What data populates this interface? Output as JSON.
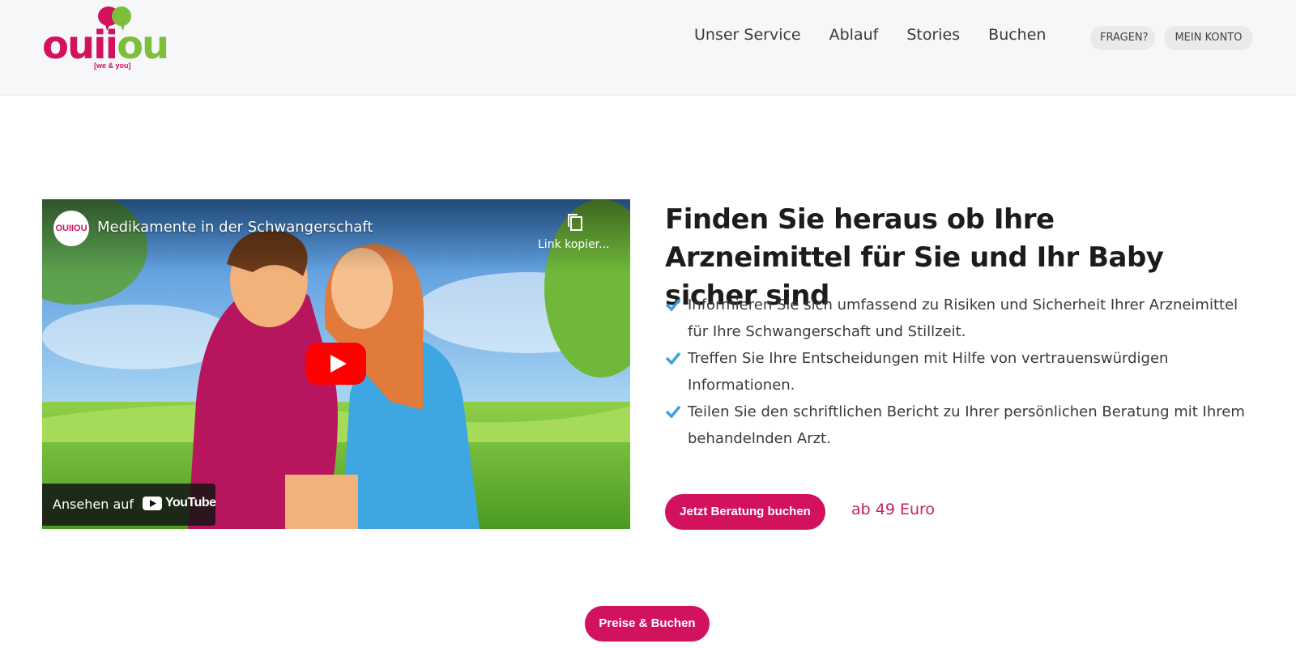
{
  "brand": {
    "logo_text_pink": "ou",
    "logo_text_mid": "ii",
    "logo_text_green": "ou",
    "logo_tagline": "[we & you]",
    "pink": "#d2125f",
    "green": "#7dbf3b"
  },
  "nav": {
    "items": [
      "Unser Service",
      "Ablauf",
      "Stories",
      "Buchen"
    ],
    "ask_label": "FRAGEN?",
    "account_label": "MEIN KONTO"
  },
  "video": {
    "channel_avatar": "OUIIOU",
    "title": "Medikamente in der Schwangerschaft",
    "copy_link_label": "Link kopier...",
    "watch_on": "Ansehen auf",
    "youtube": "YouTube"
  },
  "hero": {
    "headline": "Finden Sie heraus ob Ihre Arzneimittel für Sie und Ihr Baby sicher sind",
    "features": [
      "Informieren Sie sich umfassend zu Risiken und Sicherheit Ihrer Arzneimittel für Ihre Schwangerschaft und Stillzeit.",
      "Treffen Sie Ihre Entscheidungen mit Hilfe von vertrauenswürdigen Informationen.",
      "Teilen Sie den schriftlichen Bericht zu Ihrer persönlichen Beratung mit Ihrem behandelnden Arzt."
    ],
    "cta_label": "Jetzt Beratung buchen",
    "price_label": "ab 49 Euro"
  },
  "footer_cta": {
    "label": "Preise & Buchen"
  }
}
